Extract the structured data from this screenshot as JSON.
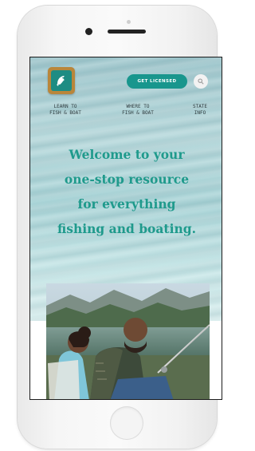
{
  "header": {
    "cta_label": "GET LICENSED",
    "logo_icon": "fish-logo-icon",
    "search_icon": "search-icon"
  },
  "nav": {
    "items": [
      {
        "line1": "LEARN TO",
        "line2": "FISH & BOAT"
      },
      {
        "line1": "WHERE TO",
        "line2": "FISH & BOAT"
      },
      {
        "line1": "STATE",
        "line2": "INFO"
      }
    ]
  },
  "hero": {
    "line1": "Welcome to your",
    "line2": "one-stop resource",
    "line3": "for everything",
    "line4": "fishing and boating."
  },
  "colors": {
    "brand_teal": "#1f9a8c",
    "button_teal": "#18968d",
    "logo_gold": "#b9863a"
  }
}
